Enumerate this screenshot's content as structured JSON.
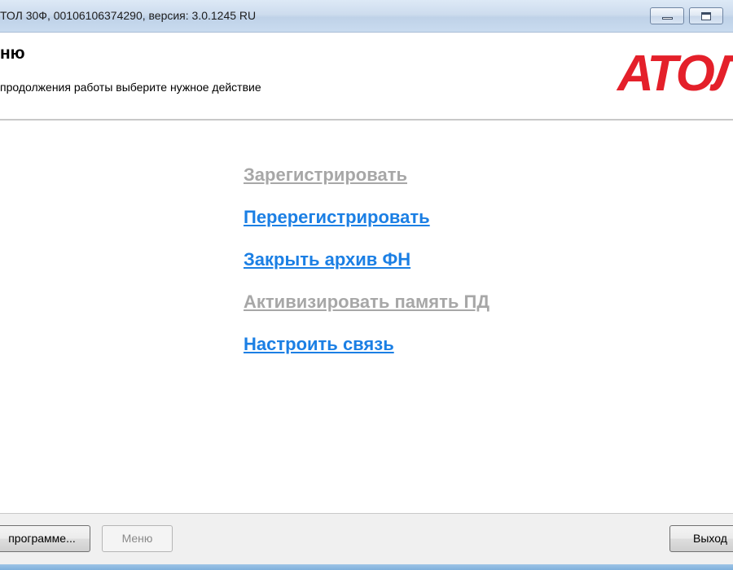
{
  "window": {
    "title": "ТОЛ 30Ф, 00106106374290, версия: 3.0.1245 RU",
    "controls": {
      "minimize": "minimize",
      "maximize": "maximize",
      "close": "close"
    }
  },
  "header": {
    "title": "ню",
    "subtitle": "продолжения работы выберите нужное действие",
    "logo_text": "АТОЛ",
    "logo_color": "#e4202a"
  },
  "actions": [
    {
      "label": "Зарегистрировать",
      "enabled": false
    },
    {
      "label": "Перерегистрировать",
      "enabled": true
    },
    {
      "label": "Закрыть архив ФН",
      "enabled": true
    },
    {
      "label": "Активизировать память ПД",
      "enabled": false
    },
    {
      "label": "Настроить связь",
      "enabled": true
    }
  ],
  "footer": {
    "about_label": "программе...",
    "menu_label": "Меню",
    "exit_label": "Выход"
  },
  "colors": {
    "link_enabled": "#1b7fe4",
    "link_disabled": "#a7a7a7"
  }
}
